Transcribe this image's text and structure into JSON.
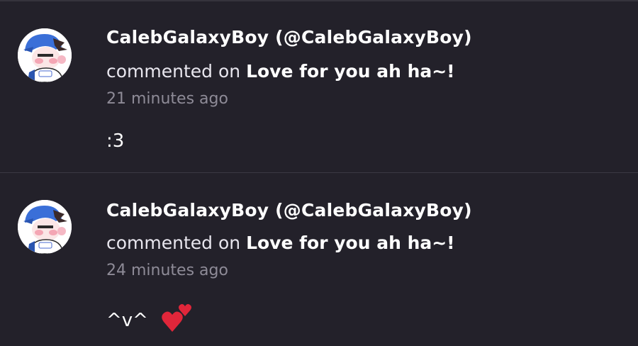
{
  "comments": [
    {
      "author": "CalebGalaxyBoy (@CalebGalaxyBoy)",
      "verb": "commented on",
      "target": "Love for you ah ha~!",
      "time": "21 minutes ago",
      "body": ":3",
      "avatar_icon": "anime-boy-avatar"
    },
    {
      "author": "CalebGalaxyBoy (@CalebGalaxyBoy)",
      "verb": "commented on",
      "target": "Love for you ah ha~!",
      "time": "24 minutes ago",
      "body": "^v^",
      "emoji_icon": "two-hearts-icon",
      "avatar_icon": "anime-boy-avatar"
    }
  ],
  "colors": {
    "background": "#23212a",
    "divider": "#3a3843",
    "muted_text": "#8e8b97",
    "heart": "#e0263a"
  }
}
